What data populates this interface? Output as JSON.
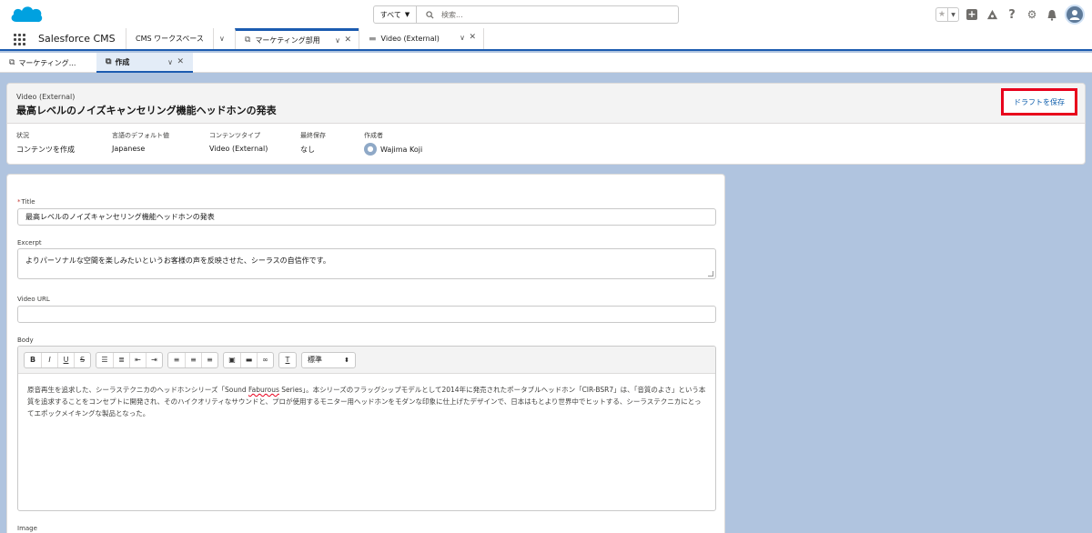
{
  "header": {
    "search_scope": "すべて",
    "search_placeholder": "検索..."
  },
  "nav": {
    "app_name": "Salesforce CMS",
    "tabs": [
      {
        "label": "CMS ワークスペース"
      },
      {
        "label": "マーケティング部用"
      },
      {
        "label": "Video (External)"
      }
    ]
  },
  "subtabs": [
    {
      "label": "マーケティング..."
    },
    {
      "label": "作成"
    }
  ],
  "record": {
    "type": "Video (External)",
    "title": "最高レベルのノイズキャンセリング機能ヘッドホンの発表",
    "save_draft": "ドラフトを保存",
    "fields": [
      {
        "label": "状況",
        "value": "コンテンツを作成"
      },
      {
        "label": "言語のデフォルト値",
        "value": "Japanese"
      },
      {
        "label": "コンテンツタイプ",
        "value": "Video (External)"
      },
      {
        "label": "最終保存",
        "value": "なし"
      },
      {
        "label": "作成者",
        "value": "Wajima Koji"
      }
    ]
  },
  "form": {
    "title_label": "Title",
    "title_value": "最高レベルのノイズキャンセリング機能ヘッドホンの発表",
    "excerpt_label": "Excerpt",
    "excerpt_value": "よりパーソナルな空間を楽しみたいというお客様の声を反映させた、シーラスの自信作です。",
    "video_url_label": "Video URL",
    "video_url_value": "",
    "body_label": "Body",
    "format_select": "標準",
    "body_part1": "原音再生を追求した、シーラステクニカのヘッドホンシリーズ「Sound ",
    "body_spell": "Faburous",
    "body_part2": " Series」。本シリーズのフラッグシップモデルとして2014年に発売されたポータブルヘッドホン「CIR-BSR7」は、「音質のよさ」という本質を追求することをコンセプトに開発され、そのハイクオリティなサウンドと、プロが使用するモニター用ヘッドホンをモダンな印象に仕上げたデザインで、日本はもとより世界中でヒットする、シーラステクニカにとってエポックメイキングな製品となった。",
    "image_label": "Image"
  }
}
